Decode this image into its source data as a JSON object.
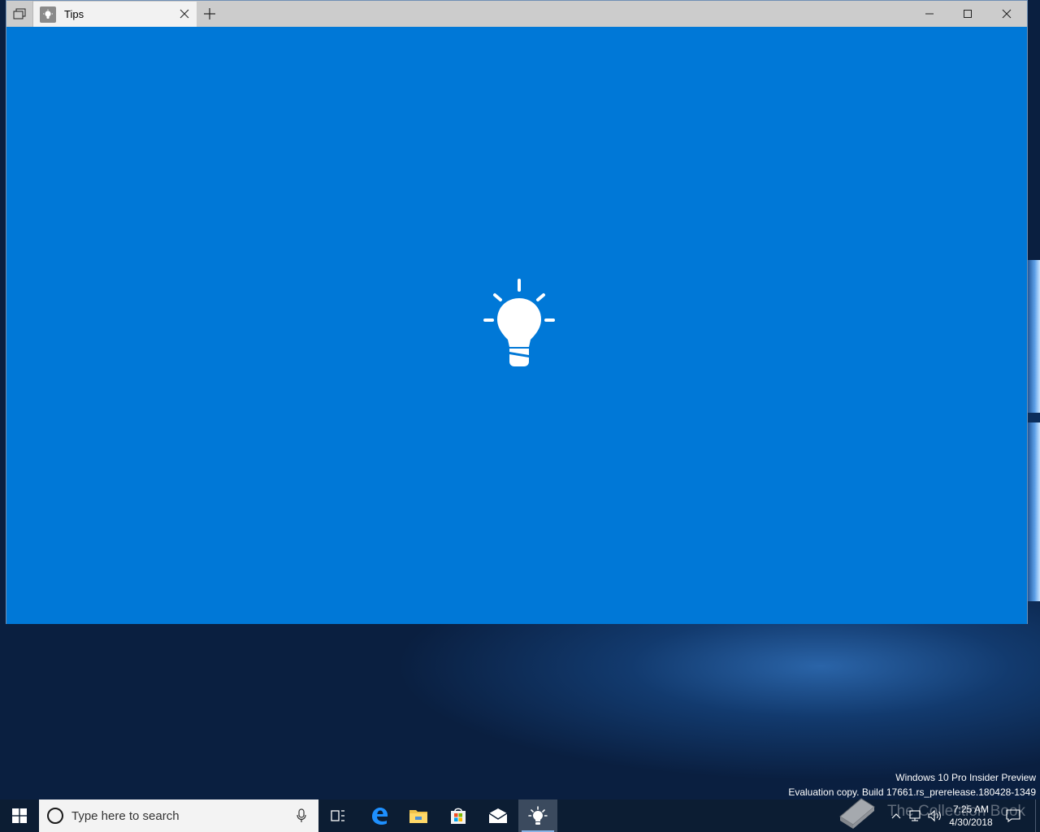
{
  "window": {
    "tab_title": "Tips",
    "tab_icon": "lightbulb-icon",
    "background_color": "#0078d7",
    "titlebar_color": "#cccccc"
  },
  "desktop": {
    "watermark_line1": "Windows 10 Pro Insider Preview",
    "watermark_line2": "Evaluation copy. Build 17661.rs_prerelease.180428-1349",
    "overlay_text": "The Collection Book"
  },
  "taskbar": {
    "search_placeholder": "Type here to search",
    "pinned": [
      "task-view-icon",
      "edge-icon",
      "file-explorer-icon",
      "store-icon",
      "mail-icon",
      "tips-icon"
    ],
    "active_app": "tips-icon",
    "clock_time": "7:25 AM",
    "clock_date": "4/30/2018"
  }
}
